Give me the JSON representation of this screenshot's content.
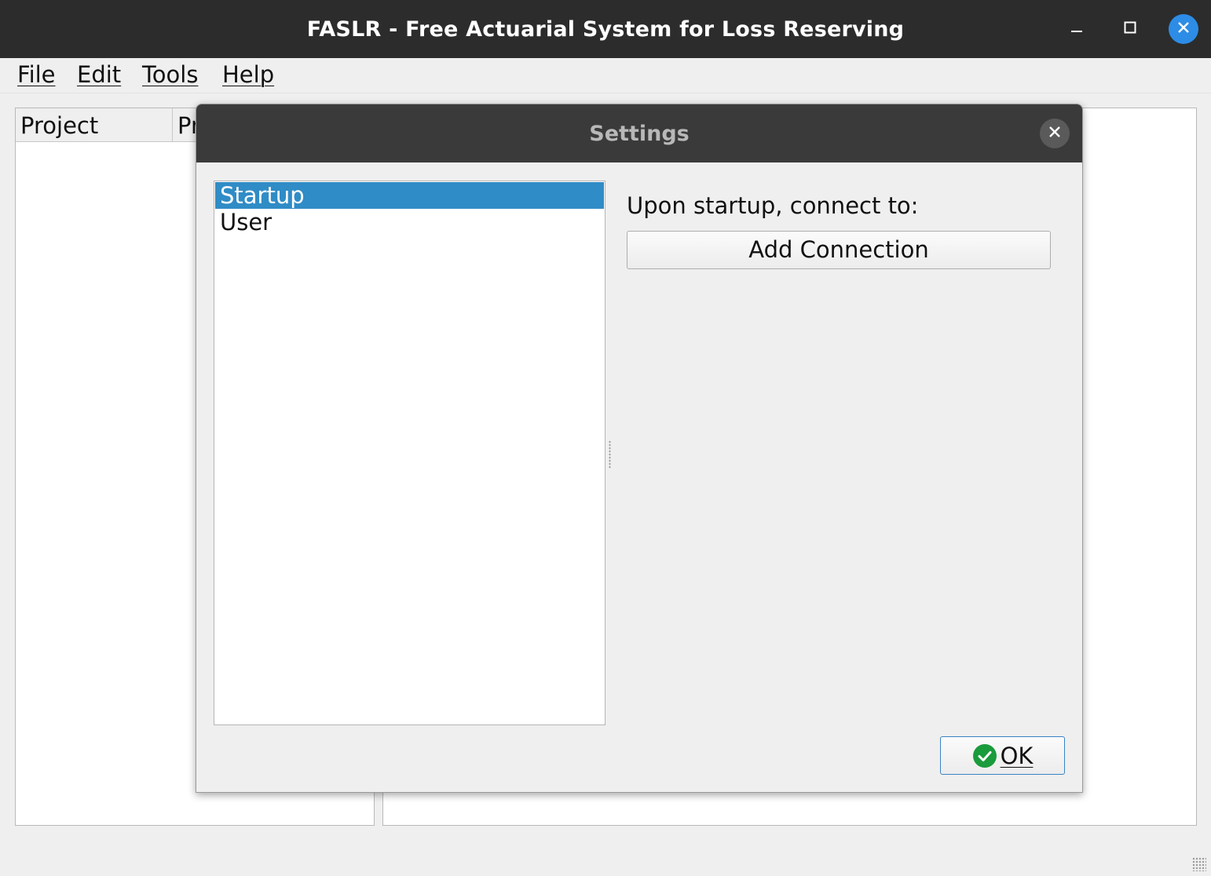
{
  "window": {
    "title": "FASLR - Free Actuarial System for Loss Reserving",
    "controls": {
      "minimize_icon": "minimize-icon",
      "maximize_icon": "maximize-icon",
      "close_icon": "close-icon",
      "close_color": "#2d8ce6"
    }
  },
  "menubar": {
    "items": [
      {
        "label": "File"
      },
      {
        "label": "Edit"
      },
      {
        "label": "Tools"
      },
      {
        "label": "Help"
      }
    ]
  },
  "project_tree": {
    "columns": [
      {
        "label": "Project"
      },
      {
        "label": "Pr"
      }
    ]
  },
  "dialog": {
    "title": "Settings",
    "close_icon": "close-icon",
    "categories": [
      {
        "label": "Startup",
        "selected": true
      },
      {
        "label": "User",
        "selected": false
      }
    ],
    "startup": {
      "label": "Upon startup, connect to:",
      "add_connection_label": "Add Connection"
    },
    "ok_button": {
      "label": "OK",
      "icon": "check-icon",
      "icon_color": "#1a9b3c"
    }
  },
  "colors": {
    "selection": "#308cc6",
    "titlebar": "#2c2c2c",
    "dialog_titlebar": "#3a3a3a"
  }
}
